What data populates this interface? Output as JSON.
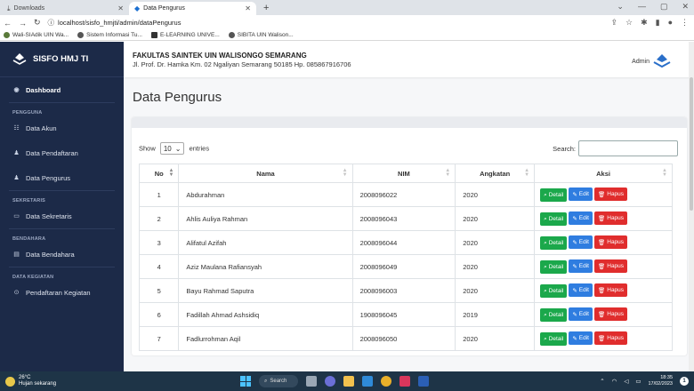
{
  "browser": {
    "tabs": [
      {
        "label": "Downloads",
        "icon": "download-icon",
        "active": false
      },
      {
        "label": "Data Pengurus",
        "icon": "site-logo-icon",
        "active": true
      }
    ],
    "new_tab": "+",
    "url": "localhost/sisfo_hmjti/admin/dataPengurus",
    "bookmarks": [
      {
        "label": "Wali-SIAdik UIN Wa...",
        "icon": "bookmark-site-icon"
      },
      {
        "label": "Sistem Informasi Tu...",
        "icon": "globe-icon"
      },
      {
        "label": "E-LEARNING UNIVE...",
        "icon": "elearning-icon"
      },
      {
        "label": "SIBITA UIN Walison...",
        "icon": "globe-icon"
      }
    ]
  },
  "app": {
    "brand": "SISFO HMJ TI",
    "faculty_name": "FAKULTAS SAINTEK UIN WALISONGO SEMARANG",
    "faculty_address": "Jl. Prof. Dr. Hamka Km. 02 Ngaliyan Semarang 50185 Hp. 085867916706",
    "admin_label": "Admin",
    "page_title": "Data Pengurus"
  },
  "sidebar": {
    "items": [
      {
        "type": "item",
        "label": "Dashboard",
        "icon": "dashboard-icon",
        "active": true
      },
      {
        "type": "heading",
        "label": "PENGGUNA"
      },
      {
        "type": "item",
        "label": "Data Akun",
        "icon": "users-icon"
      },
      {
        "type": "item",
        "label": "Data Pendaftaran",
        "icon": "user-plus-icon"
      },
      {
        "type": "item",
        "label": "Data Pengurus",
        "icon": "user-icon"
      },
      {
        "type": "heading",
        "label": "SEKRETARIS"
      },
      {
        "type": "item",
        "label": "Data Sekretaris",
        "icon": "folder-icon"
      },
      {
        "type": "heading",
        "label": "BENDAHARA"
      },
      {
        "type": "item",
        "label": "Data Bendahara",
        "icon": "money-icon"
      },
      {
        "type": "heading",
        "label": "DATA KEGIATAN"
      },
      {
        "type": "item",
        "label": "Pendaftaran Kegiatan",
        "icon": "calendar-icon"
      }
    ]
  },
  "table_controls": {
    "show_label": "Show",
    "show_value": "10",
    "entries_label": "entries",
    "search_label": "Search:",
    "search_value": ""
  },
  "table": {
    "columns": [
      "No",
      "Nama",
      "NIM",
      "Angkatan",
      "Aksi"
    ],
    "rows": [
      {
        "no": "1",
        "nama": "Abdurahman",
        "nim": "2008096022",
        "angkatan": "2020"
      },
      {
        "no": "2",
        "nama": "Ahlis Auliya Rahman",
        "nim": "2008096043",
        "angkatan": "2020"
      },
      {
        "no": "3",
        "nama": "Alifatul Azifah",
        "nim": "2008096044",
        "angkatan": "2020"
      },
      {
        "no": "4",
        "nama": "Aziz Maulana Rafiansyah",
        "nim": "2008096049",
        "angkatan": "2020"
      },
      {
        "no": "5",
        "nama": "Bayu Rahmad Saputra",
        "nim": "2008096003",
        "angkatan": "2020"
      },
      {
        "no": "6",
        "nama": "Fadillah Ahmad Ashsidiq",
        "nim": "1908096045",
        "angkatan": "2019"
      },
      {
        "no": "7",
        "nama": "Fadlurrohman Aqil",
        "nim": "2008096050",
        "angkatan": "2020"
      }
    ],
    "actions": {
      "detail": "Detail",
      "edit": "Edit",
      "hapus": "Hapus"
    }
  },
  "taskbar": {
    "temperature": "26°C",
    "weather_text": "Hujan sekarang",
    "search_label": "Search",
    "time": "18:35",
    "date": "17/02/2023",
    "notification_count": "1"
  },
  "colors": {
    "sidebar_bg": "#1c2a48",
    "detail_btn": "#1ba84b",
    "edit_btn": "#2f7de0",
    "hapus_btn": "#e02d2d",
    "taskbar_bg": "#1e3447"
  }
}
